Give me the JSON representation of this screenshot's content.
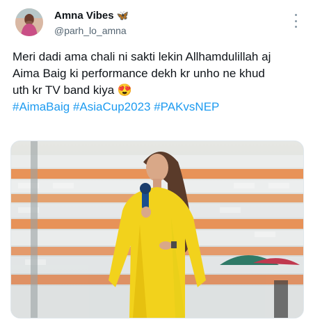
{
  "user": {
    "display_name": "Amna Vibes",
    "name_emoji": "🦋",
    "handle": "@parh_lo_amna",
    "avatar_icon": "avatar-photo"
  },
  "tweet": {
    "lines": [
      "Meri dadi ama chali ni sakti lekin Allhamdulillah aj",
      "Aima Baig ki performance dekh kr unho ne khud",
      "uth kr TV band kiya"
    ],
    "emoji": "😍",
    "hashtags": [
      "#AimaBaig",
      "#AsiaCup2023",
      "#PAKvsNEP"
    ]
  },
  "media": {
    "description_icon": "singer-performance-photo",
    "accent_colors": {
      "outfit": "#f2d21c",
      "stands_orange": "#e98a4a",
      "stands_white": "#e9ecee"
    }
  },
  "icons": {
    "more": "more-vertical-icon"
  }
}
